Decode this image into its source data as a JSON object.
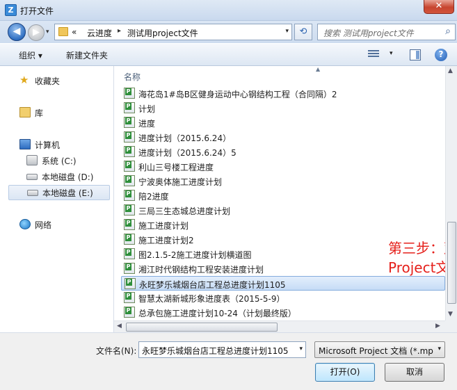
{
  "window": {
    "title": "打开文件",
    "close": "✕"
  },
  "nav": {
    "back": "◀",
    "forward": "▶",
    "history_dd": "▾",
    "breadcrumb": [
      "«",
      "云进度",
      "测试用project文件"
    ],
    "breadcrumb_sep": "▸",
    "address_dd": "▾",
    "refresh": "⟲",
    "search_placeholder": "搜索 测试用project文件",
    "search_icon": "⌕"
  },
  "toolbar": {
    "organize": "组织 ▾",
    "new_folder": "新建文件夹",
    "view_dd": "▾",
    "help": "?"
  },
  "sidebar": {
    "favorites": "收藏夹",
    "libraries": "库",
    "computer": "计算机",
    "drives": [
      {
        "label": "系统 (C:)",
        "selected": false
      },
      {
        "label": "本地磁盘 (D:)",
        "selected": false
      },
      {
        "label": "本地磁盘 (E:)",
        "selected": true
      }
    ],
    "network": "网络"
  },
  "filelist": {
    "column_name": "名称",
    "sort_indicator": "▲",
    "files": [
      {
        "name": "海花岛1#岛B区健身运动中心钢结构工程（合同隔）2",
        "selected": false
      },
      {
        "name": "计划",
        "selected": false
      },
      {
        "name": "进度",
        "selected": false
      },
      {
        "name": "进度计划（2015.6.24）",
        "selected": false
      },
      {
        "name": "进度计划（2015.6.24）5",
        "selected": false
      },
      {
        "name": "利山三号楼工程进度",
        "selected": false
      },
      {
        "name": "宁波奥体施工进度计划",
        "selected": false
      },
      {
        "name": "陪2进度",
        "selected": false
      },
      {
        "name": "三局三生态城总进度计划",
        "selected": false
      },
      {
        "name": "施工进度计划",
        "selected": false
      },
      {
        "name": "施工进度计划2",
        "selected": false
      },
      {
        "name": "图2.1.5-2施工进度计划横道图",
        "selected": false
      },
      {
        "name": "湘江时代钢结构工程安装进度计划",
        "selected": false
      },
      {
        "name": "永旺梦乐城烟台店工程总进度计划1105",
        "selected": true
      },
      {
        "name": "智慧太湖新城形象进度表（2015-5-9）",
        "selected": false
      },
      {
        "name": "总承包施工进度计划10-24（计划最终版）",
        "selected": false
      }
    ],
    "annotation_line1": "第三步：双击要导入的",
    "annotation_line2": "Project文件"
  },
  "scroll": {
    "up": "▲",
    "down": "▼",
    "left": "◀",
    "right": "▶"
  },
  "bottom": {
    "filename_label": "文件名(N):",
    "filename_value": "永旺梦乐城烟台店工程总进度计划1105",
    "filename_dd": "▾",
    "filetype_value": "Microsoft Project 文档 (*.mp",
    "filetype_dd": "▾",
    "open_button": "打开(O)",
    "cancel_button": "取消"
  },
  "colors": {
    "annotation": "#e5201b",
    "selection": "#c6dcf6"
  }
}
